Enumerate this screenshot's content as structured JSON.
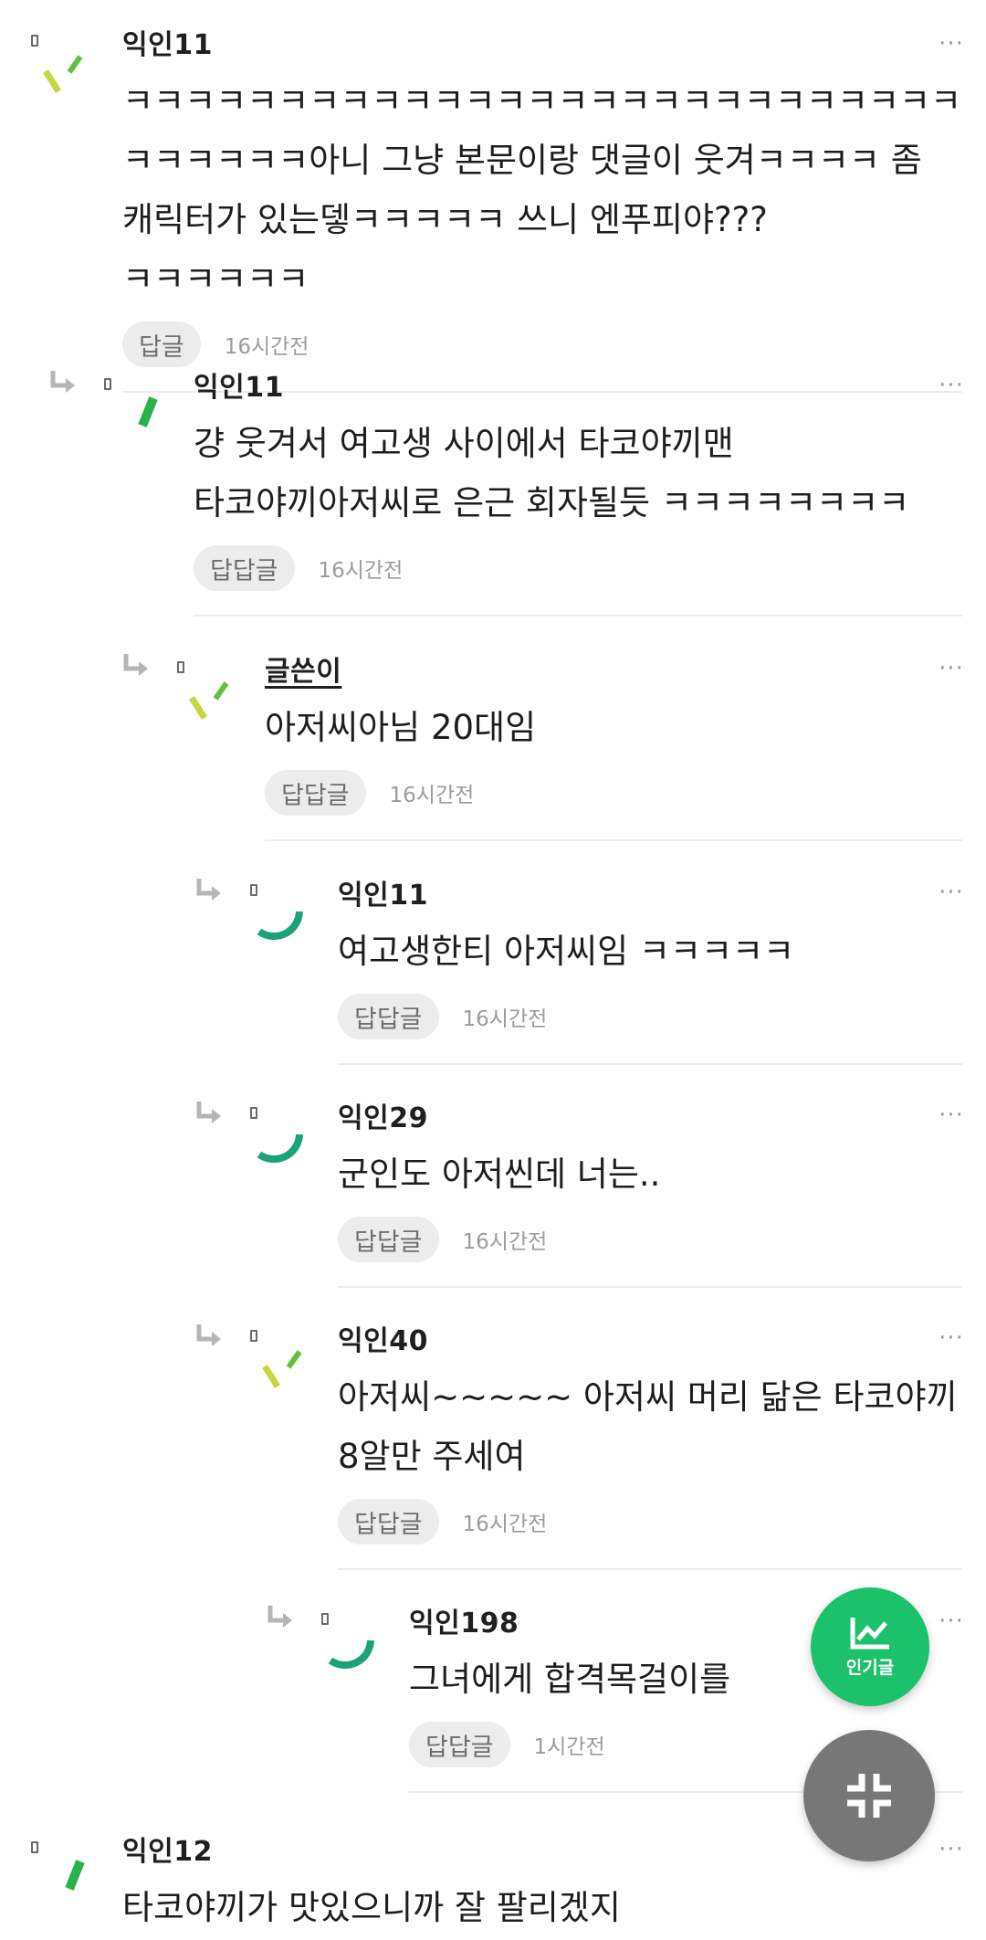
{
  "comments": [
    {
      "author": "익인11",
      "text": "ㅋㅋㅋㅋㅋㅋㅋㅋㅋㅋㅋㅋㅋㅋㅋㅋㅋㅋㅋㅋㅋㅋㅋㅋㅋㅋㅋㅋㅋㅋㅋㅋㅋ아니 그냥 본문이랑 댓글이 웃겨ㅋㅋㅋㅋ 좀 캐릭터가 있는뎋ㅋㅋㅋㅋㅋ 쓰니 엔푸피야??? ㅋㅋㅋㅋㅋㅋ",
      "reply_label": "답글",
      "time": "16시간전",
      "more": "···"
    },
    {
      "author": "익인11",
      "text": "걍 웃겨서 여고생 사이에서 타코야끼맨 타코야끼아저씨로 은근 회자될듯 ㅋㅋㅋㅋㅋㅋㅋㅋ",
      "reply_label": "답답글",
      "time": "16시간전",
      "more": "···"
    },
    {
      "author": "글쓴이",
      "text": "아저씨아님 20대임",
      "reply_label": "답답글",
      "time": "16시간전",
      "more": "···"
    },
    {
      "author": "익인11",
      "text": "여고생한티 아저씨임 ㅋㅋㅋㅋㅋ",
      "reply_label": "답답글",
      "time": "16시간전",
      "more": "···"
    },
    {
      "author": "익인29",
      "text": "군인도 아저씬데 너는..",
      "reply_label": "답답글",
      "time": "16시간전",
      "more": "···"
    },
    {
      "author": "익인40",
      "text": "아저씨~~~~~ 아저씨 머리 닮은 타코야끼 8알만 주세여",
      "reply_label": "답답글",
      "time": "16시간전",
      "more": "···"
    },
    {
      "author": "익인198",
      "text": "그녀에게 합격목걸이를",
      "reply_label": "답답글",
      "time": "1시간전",
      "more": "···"
    },
    {
      "author": "익인12",
      "text": "타코야끼가 맛있으니까 잘 팔리겠지",
      "reply_label": "",
      "time": "",
      "more": "···"
    }
  ],
  "fab": {
    "popular_label": "인기글",
    "popular_icon": "trend-chart-icon",
    "collapse_icon": "collapse-icon"
  },
  "colors": {
    "accent": "#1cc16b",
    "fab_gray": "#777777",
    "lime": "#c6d63c",
    "green": "#5fc13b",
    "teal": "#1aa37a"
  }
}
